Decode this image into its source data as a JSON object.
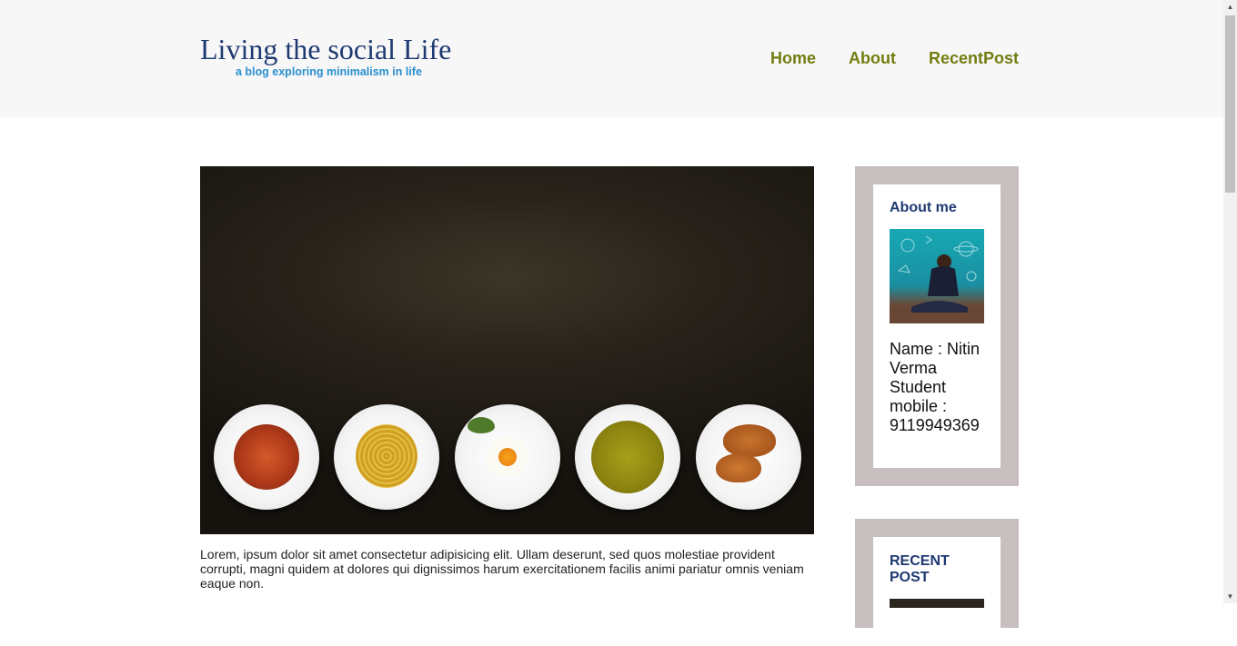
{
  "header": {
    "title": "Living the social Life",
    "tagline": "a blog exploring minimalism in life"
  },
  "nav": {
    "items": [
      {
        "label": "Home"
      },
      {
        "label": "About"
      },
      {
        "label": "RecentPost"
      }
    ]
  },
  "post": {
    "text": "Lorem, ipsum dolor sit amet consectetur adipisicing elit. Ullam deserunt, sed quos molestiae provident corrupti, magni quidem at dolores qui dignissimos harum exercitationem facilis animi pariatur omnis veniam eaque non."
  },
  "sidebar": {
    "about": {
      "title": "About me",
      "name_line": "Name : Nitin Verma",
      "role_line": "Student",
      "mobile_line": "mobile : 9119949369"
    },
    "recent": {
      "title": "RECENT POST"
    }
  },
  "colors": {
    "header_bg": "#f7f7f7",
    "title": "#1e3a72",
    "tagline": "#2a8fd0",
    "nav": "#737d10",
    "widget_border": "#c6bebf"
  }
}
